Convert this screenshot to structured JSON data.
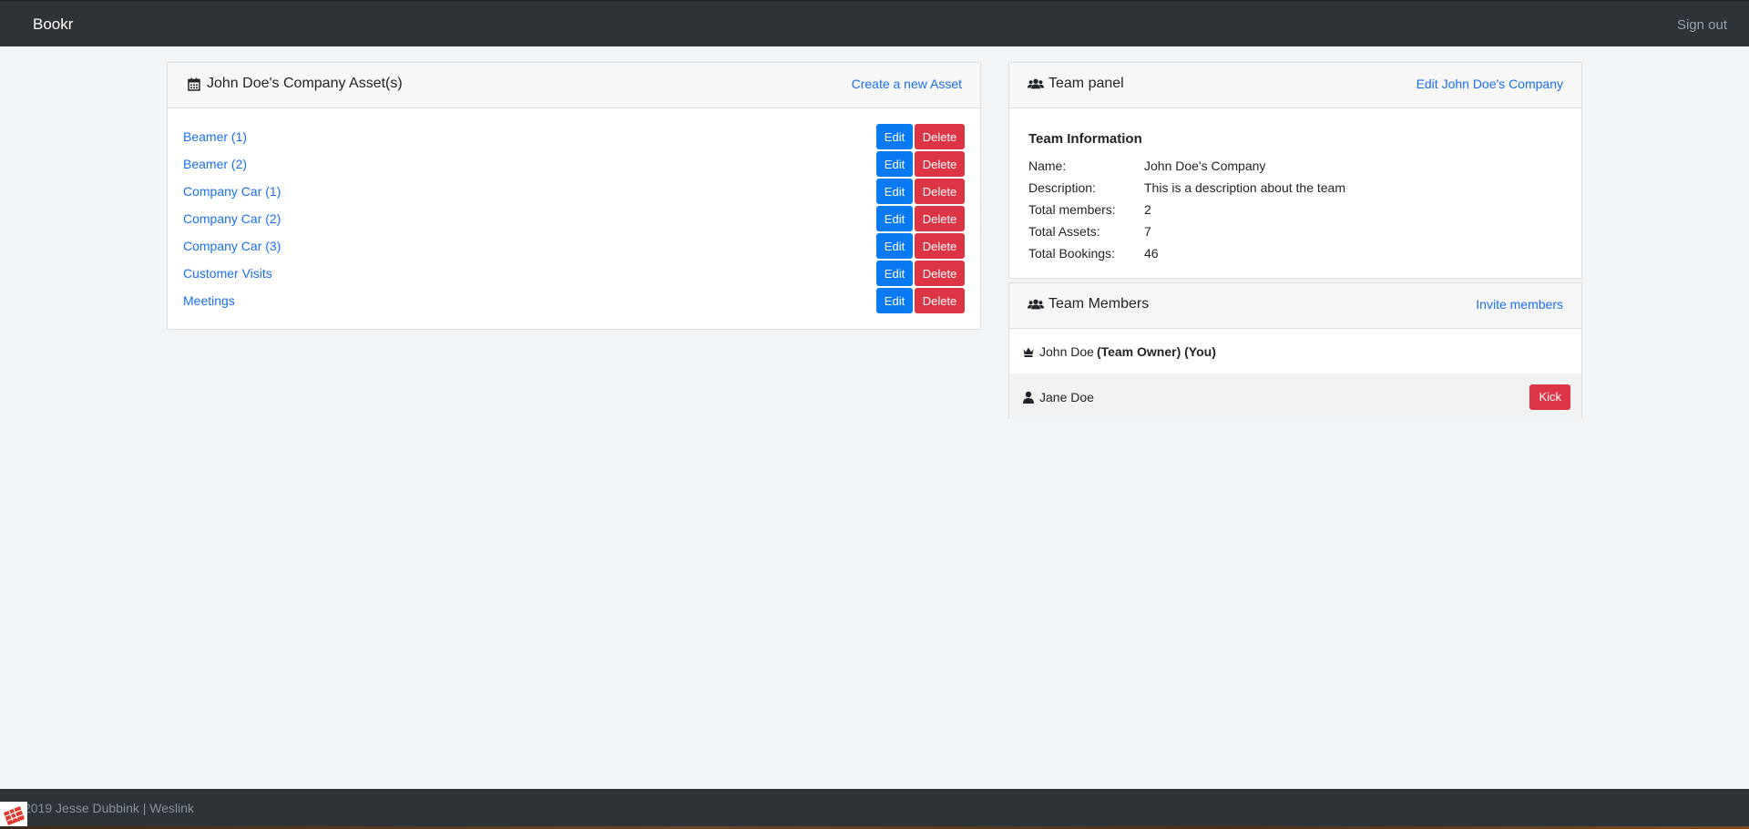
{
  "navbar": {
    "brand": "Bookr",
    "signout": "Sign out"
  },
  "assets": {
    "title": "John Doe's Company Asset(s)",
    "title_icon": "calendar-icon",
    "create_link": "Create a new Asset",
    "edit_label": "Edit",
    "delete_label": "Delete",
    "items": [
      {
        "name": "Beamer (1)"
      },
      {
        "name": "Beamer (2)"
      },
      {
        "name": "Company Car (1)"
      },
      {
        "name": "Company Car (2)"
      },
      {
        "name": "Company Car (3)"
      },
      {
        "name": "Customer Visits"
      },
      {
        "name": "Meetings"
      }
    ]
  },
  "team_panel": {
    "title": "Team panel",
    "title_icon": "users-icon",
    "edit_link": "Edit John Doe's Company",
    "info_title": "Team Information",
    "info": [
      {
        "label": "Name:",
        "value": "John Doe's Company"
      },
      {
        "label": "Description:",
        "value": "This is a description about the team"
      },
      {
        "label": "Total members:",
        "value": "2"
      },
      {
        "label": "Total Assets:",
        "value": "7"
      },
      {
        "label": "Total Bookings:",
        "value": "46"
      }
    ]
  },
  "team_members": {
    "title": "Team Members",
    "title_icon": "users-icon",
    "invite_link": "Invite members",
    "kick_label": "Kick",
    "members": [
      {
        "name": "John Doe",
        "badge": "(Team Owner) (You)",
        "icon": "crown-icon"
      },
      {
        "name": "Jane Doe",
        "badge": "",
        "icon": "user-icon"
      }
    ]
  },
  "footer": {
    "text": "2019 Jesse Dubbink | Weslink"
  },
  "colors": {
    "navbar_bg": "#2e3338",
    "page_bg": "#f2f5f8",
    "link": "#1a6ff2",
    "primary": "#0a7af2",
    "danger": "#dc3545"
  }
}
